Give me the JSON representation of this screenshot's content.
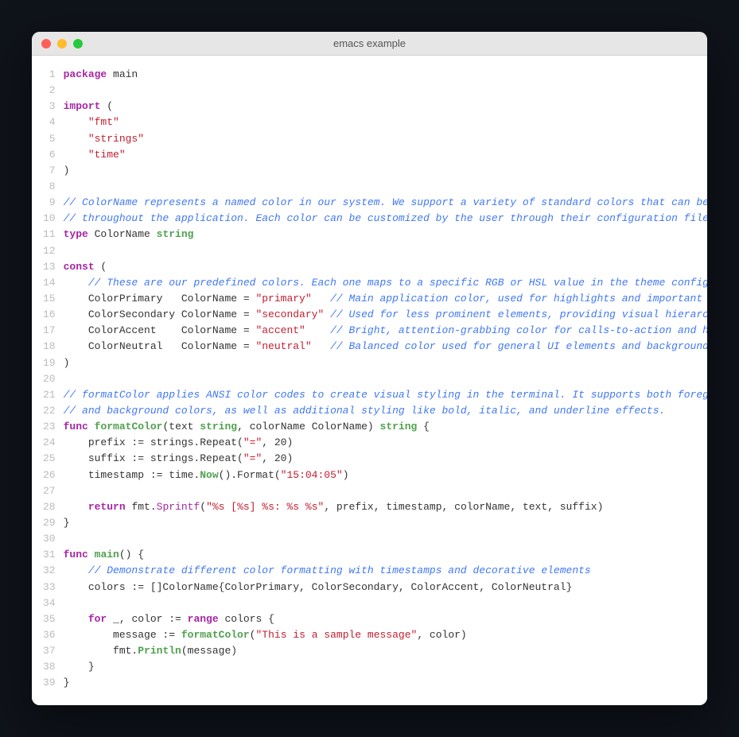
{
  "window": {
    "title": "emacs example"
  },
  "lines": [
    {
      "n": 1,
      "tokens": [
        [
          "kw",
          "package"
        ],
        [
          "",
          " main"
        ]
      ]
    },
    {
      "n": 2,
      "tokens": [
        [
          "",
          ""
        ]
      ]
    },
    {
      "n": 3,
      "tokens": [
        [
          "kw",
          "import"
        ],
        [
          "",
          " ("
        ]
      ]
    },
    {
      "n": 4,
      "tokens": [
        [
          "",
          "    "
        ],
        [
          "str",
          "\"fmt\""
        ]
      ]
    },
    {
      "n": 5,
      "tokens": [
        [
          "",
          "    "
        ],
        [
          "str",
          "\"strings\""
        ]
      ]
    },
    {
      "n": 6,
      "tokens": [
        [
          "",
          "    "
        ],
        [
          "str",
          "\"time\""
        ]
      ]
    },
    {
      "n": 7,
      "tokens": [
        [
          "",
          ")"
        ]
      ]
    },
    {
      "n": 8,
      "tokens": [
        [
          "",
          ""
        ]
      ]
    },
    {
      "n": 9,
      "tokens": [
        [
          "cmt",
          "// ColorName represents a named color in our system. We support a variety of standard colors that can be used"
        ]
      ]
    },
    {
      "n": 10,
      "tokens": [
        [
          "cmt",
          "// throughout the application. Each color can be customized by the user through their configuration file."
        ]
      ]
    },
    {
      "n": 11,
      "tokens": [
        [
          "kw",
          "type"
        ],
        [
          "",
          " ColorName "
        ],
        [
          "type",
          "string"
        ]
      ]
    },
    {
      "n": 12,
      "tokens": [
        [
          "",
          ""
        ]
      ]
    },
    {
      "n": 13,
      "tokens": [
        [
          "kw",
          "const"
        ],
        [
          "",
          " ("
        ]
      ]
    },
    {
      "n": 14,
      "tokens": [
        [
          "",
          "    "
        ],
        [
          "cmt",
          "// These are our predefined colors. Each one maps to a specific RGB or HSL value in the theme configuration."
        ]
      ]
    },
    {
      "n": 15,
      "tokens": [
        [
          "",
          "    ColorPrimary   ColorName = "
        ],
        [
          "str",
          "\"primary\""
        ],
        [
          "",
          "   "
        ],
        [
          "cmt",
          "// Main application color, used for highlights and important UI elements"
        ]
      ]
    },
    {
      "n": 16,
      "tokens": [
        [
          "",
          "    ColorSecondary ColorName = "
        ],
        [
          "str",
          "\"secondary\""
        ],
        [
          "",
          " "
        ],
        [
          "cmt",
          "// Used for less prominent elements, providing visual hierarchy"
        ]
      ]
    },
    {
      "n": 17,
      "tokens": [
        [
          "",
          "    ColorAccent    ColorName = "
        ],
        [
          "str",
          "\"accent\""
        ],
        [
          "",
          "    "
        ],
        [
          "cmt",
          "// Bright, attention-grabbing color for calls-to-action and highlights"
        ]
      ]
    },
    {
      "n": 18,
      "tokens": [
        [
          "",
          "    ColorNeutral   ColorName = "
        ],
        [
          "str",
          "\"neutral\""
        ],
        [
          "",
          "   "
        ],
        [
          "cmt",
          "// Balanced color used for general UI elements and backgrounds"
        ]
      ]
    },
    {
      "n": 19,
      "tokens": [
        [
          "",
          ")"
        ]
      ]
    },
    {
      "n": 20,
      "tokens": [
        [
          "",
          ""
        ]
      ]
    },
    {
      "n": 21,
      "tokens": [
        [
          "cmt",
          "// formatColor applies ANSI color codes to create visual styling in the terminal. It supports both foreground"
        ]
      ]
    },
    {
      "n": 22,
      "tokens": [
        [
          "cmt",
          "// and background colors, as well as additional styling like bold, italic, and underline effects."
        ]
      ]
    },
    {
      "n": 23,
      "tokens": [
        [
          "kw",
          "func"
        ],
        [
          "",
          " "
        ],
        [
          "fn",
          "formatColor"
        ],
        [
          "",
          "(text "
        ],
        [
          "type",
          "string"
        ],
        [
          "",
          ", colorName ColorName) "
        ],
        [
          "type",
          "string"
        ],
        [
          "",
          " {"
        ]
      ]
    },
    {
      "n": 24,
      "tokens": [
        [
          "",
          "    prefix := strings.Repeat("
        ],
        [
          "str",
          "\"=\""
        ],
        [
          "",
          ", 20)"
        ]
      ]
    },
    {
      "n": 25,
      "tokens": [
        [
          "",
          "    suffix := strings.Repeat("
        ],
        [
          "str",
          "\"=\""
        ],
        [
          "",
          ", 20)"
        ]
      ]
    },
    {
      "n": 26,
      "tokens": [
        [
          "",
          "    timestamp := time."
        ],
        [
          "fn",
          "Now"
        ],
        [
          "",
          "().Format("
        ],
        [
          "str",
          "\"15:04:05\""
        ],
        [
          "",
          ")"
        ]
      ]
    },
    {
      "n": 27,
      "tokens": [
        [
          "",
          ""
        ]
      ]
    },
    {
      "n": 28,
      "tokens": [
        [
          "",
          "    "
        ],
        [
          "kw",
          "return"
        ],
        [
          "",
          " fmt."
        ],
        [
          "fn2",
          "Sprintf"
        ],
        [
          "",
          "("
        ],
        [
          "str",
          "\"%s [%s] %s: %s %s\""
        ],
        [
          "",
          ", prefix, timestamp, colorName, text, suffix)"
        ]
      ]
    },
    {
      "n": 29,
      "tokens": [
        [
          "",
          "}"
        ]
      ]
    },
    {
      "n": 30,
      "tokens": [
        [
          "",
          ""
        ]
      ]
    },
    {
      "n": 31,
      "tokens": [
        [
          "kw",
          "func"
        ],
        [
          "",
          " "
        ],
        [
          "fn",
          "main"
        ],
        [
          "",
          "() {"
        ]
      ]
    },
    {
      "n": 32,
      "tokens": [
        [
          "",
          "    "
        ],
        [
          "cmt",
          "// Demonstrate different color formatting with timestamps and decorative elements"
        ]
      ]
    },
    {
      "n": 33,
      "tokens": [
        [
          "",
          "    colors := []ColorName{ColorPrimary, ColorSecondary, ColorAccent, ColorNeutral}"
        ]
      ]
    },
    {
      "n": 34,
      "tokens": [
        [
          "",
          ""
        ]
      ]
    },
    {
      "n": 35,
      "tokens": [
        [
          "",
          "    "
        ],
        [
          "kw",
          "for"
        ],
        [
          "",
          " _, color := "
        ],
        [
          "kw",
          "range"
        ],
        [
          "",
          " colors {"
        ]
      ]
    },
    {
      "n": 36,
      "tokens": [
        [
          "",
          "        message := "
        ],
        [
          "fn",
          "formatColor"
        ],
        [
          "",
          "("
        ],
        [
          "str",
          "\"This is a sample message\""
        ],
        [
          "",
          ", color)"
        ]
      ]
    },
    {
      "n": 37,
      "tokens": [
        [
          "",
          "        fmt."
        ],
        [
          "fn",
          "Println"
        ],
        [
          "",
          "(message)"
        ]
      ]
    },
    {
      "n": 38,
      "tokens": [
        [
          "",
          "    }"
        ]
      ]
    },
    {
      "n": 39,
      "tokens": [
        [
          "",
          "}"
        ]
      ]
    }
  ]
}
